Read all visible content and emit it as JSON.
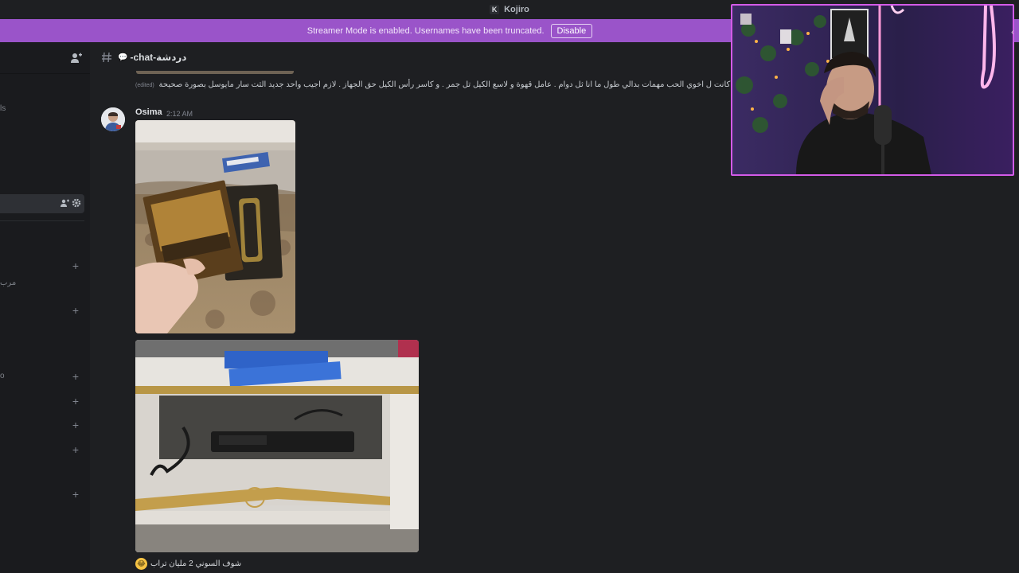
{
  "titlebar": {
    "logo": "K",
    "app_name": "Kojiro"
  },
  "banner": {
    "text": "Streamer Mode is enabled. Usernames have been truncated.",
    "button_label": "Disable"
  },
  "sidebar": {
    "fragments": [
      "ls",
      "مرب",
      "o"
    ]
  },
  "channel": {
    "icon": "hash-icon",
    "emoji": "💬",
    "name": "-chat-دردشة"
  },
  "previous_message": {
    "edited_label": "(edited)",
    "text": "كانت ل اخوي الحب مهمات بدالي طول ما انا ثل دوام . عامل قهوة و لاسع الكيل تل جمر . و كاسر رأس الكيل حق الجهاز . لازم اجيب واحد جديد الثت سار مايوسل بصورة صحيحة"
  },
  "message": {
    "author": "Osima",
    "time": "2:12 AM",
    "attachments": [
      "photo-books-tv-stand",
      "photo-ps2-console-tv-stand"
    ],
    "caption_emoji": "😂",
    "caption": "شوف السوني 2 مليان تراب"
  },
  "colors": {
    "banner": "#9a54c9",
    "background": "#1e1f22",
    "sidebar": "#1a1b1e",
    "webcam_border": "#d35be8"
  }
}
